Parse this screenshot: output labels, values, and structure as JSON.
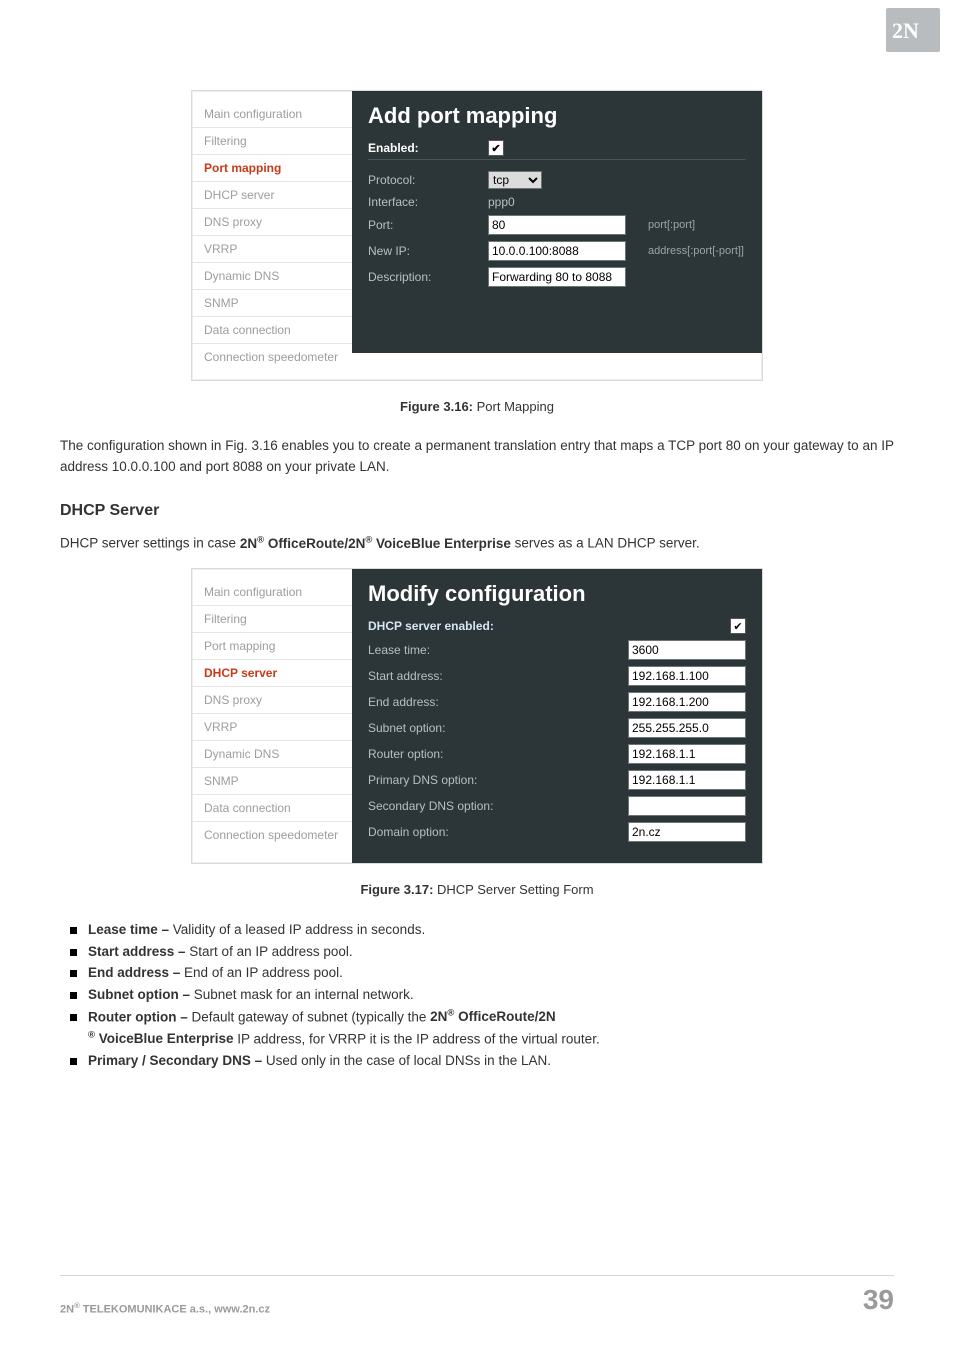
{
  "logo_text": "2N",
  "fig1": {
    "nav": [
      "Main configuration",
      "Filtering",
      "Port mapping",
      "DHCP server",
      "DNS proxy",
      "VRRP",
      "Dynamic DNS",
      "SNMP",
      "Data connection",
      "Connection speedometer"
    ],
    "nav_active_index": 2,
    "title": "Add port mapping",
    "rows": {
      "enabled_label": "Enabled:",
      "enabled_check": "✔",
      "protocol_label": "Protocol:",
      "protocol_value": "tcp",
      "interface_label": "Interface:",
      "interface_value": "ppp0",
      "port_label": "Port:",
      "port_value": "80",
      "port_hint": "port[:port]",
      "newip_label": "New IP:",
      "newip_value": "10.0.0.100:8088",
      "newip_hint": "address[:port[-port]]",
      "desc_label": "Description:",
      "desc_value": "Forwarding 80 to 8088"
    }
  },
  "caption1_bold": "Figure 3.16:",
  "caption1_rest": " Port Mapping",
  "para1": "The configuration shown in Fig. 3.16 enables you to create a permanent translation entry that maps a TCP port 80 on your gateway to an IP address 10.0.0.100 and port 8088 on your private LAN.",
  "dhcp_heading": "DHCP Server",
  "para2_a": "DHCP server settings in case ",
  "para2_b": "2N",
  "para2_c": " OfficeRoute/2N",
  "para2_d": " VoiceBlue Enterprise",
  "para2_e": " serves as a LAN DHCP server.",
  "fig2": {
    "nav": [
      "Main configuration",
      "Filtering",
      "Port mapping",
      "DHCP server",
      "DNS proxy",
      "VRRP",
      "Dynamic DNS",
      "SNMP",
      "Data connection",
      "Connection speedometer"
    ],
    "nav_active_index": 3,
    "title": "Modify configuration",
    "rows": {
      "enabled_label": "DHCP server enabled:",
      "enabled_check": "✔",
      "lease_label": "Lease time:",
      "lease_value": "3600",
      "start_label": "Start address:",
      "start_value": "192.168.1.100",
      "end_label": "End address:",
      "end_value": "192.168.1.200",
      "subnet_label": "Subnet option:",
      "subnet_value": "255.255.255.0",
      "router_label": "Router option:",
      "router_value": "192.168.1.1",
      "pdns_label": "Primary DNS option:",
      "pdns_value": "192.168.1.1",
      "sdns_label": "Secondary DNS option:",
      "sdns_value": "",
      "domain_label": "Domain option:",
      "domain_value": "2n.cz"
    }
  },
  "caption2_bold": "Figure 3.17:",
  "caption2_rest": " DHCP Server Setting Form",
  "bullets": {
    "b1_bold": "Lease time – ",
    "b1_rest": "Validity of a leased IP address in seconds.",
    "b2_bold": "Start address – ",
    "b2_rest": "Start of an IP address pool.",
    "b3_bold": "End address – ",
    "b3_rest": "End of an IP address pool.",
    "b4_bold": "Subnet option – ",
    "b4_rest": "Subnet mask for an internal network.",
    "b5_bold": "Router option – ",
    "b5_mid": "Default gateway of subnet (typically the ",
    "b5_p1": "2N",
    "b5_p2": " OfficeRoute/2N",
    "b5_p3": " VoiceBlue Enterprise",
    "b5_tail": " IP address, for VRRP it is the IP address of the virtual router.",
    "b6_bold": "Primary / Secondary DNS – ",
    "b6_rest": "Used only in the case of local DNSs in the LAN."
  },
  "footer": {
    "left_a": "2N",
    "left_b": " TELEKOMUNIKACE a.s., www.2n.cz",
    "page": "39"
  }
}
